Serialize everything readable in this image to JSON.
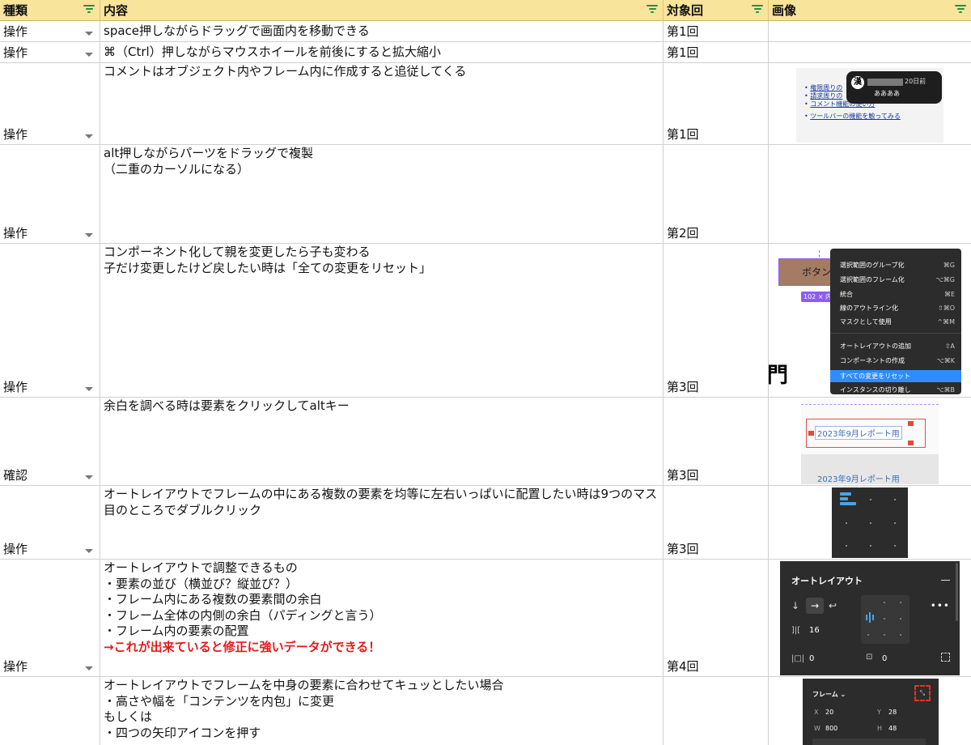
{
  "headers": {
    "type": "種類",
    "content": "内容",
    "round": "対象回",
    "image": "画像"
  },
  "rows": [
    {
      "type": "操作",
      "content": "space押しながらドラッグで画面内を移動できる",
      "round": "第1回"
    },
    {
      "type": "操作",
      "content": "⌘（Ctrl）押しながらマウスホイールを前後にすると拡大縮小",
      "round": "第1回"
    },
    {
      "type": "操作",
      "content": "コメントはオブジェクト内やフレーム内に作成すると追従してくる",
      "round": "第1回"
    },
    {
      "type": "操作",
      "content": "alt押しながらパーツをドラッグで複製\n（二重のカーソルになる）",
      "round": "第2回"
    },
    {
      "type": "操作",
      "content": "コンポーネント化して親を変更したら子も変わる\n子だけ変更したけど戻したい時は「全ての変更をリセット」",
      "round": "第3回"
    },
    {
      "type": "確認",
      "content": "余白を調べる時は要素をクリックしてaltキー",
      "round": "第3回"
    },
    {
      "type": "操作",
      "content": "オートレイアウトでフレームの中にある複数の要素を均等に左右いっぱいに配置したい時は9つのマス目のところでダブルクリック",
      "round": "第3回"
    },
    {
      "type": "操作",
      "content": "オートレイアウトで調整できるもの\n・要素の並び（横並び？縦並び？）\n・フレーム内にある複数の要素間の余白\n・フレーム全体の内側の余白（パディングと言う）\n・フレーム内の要素の配置\n",
      "content_emphasis": "→これが出来ていると修正に強いデータができる！",
      "round": "第4回"
    },
    {
      "type": "",
      "content": "オートレイアウトでフレームを中身の要素に合わせてキュッとしたい場合\n・高さや幅を「コンテンツを内包」に変更\nもしくは\n・四つの矢印アイコンを押す",
      "round": ""
    }
  ],
  "thumbs": {
    "comment": {
      "list": [
        "権限周りの",
        "請求周りの",
        "コメント機能の使い方",
        "ツールバーの機能を触ってみる"
      ],
      "avatar": "漢",
      "time": "20日前",
      "text": "ああああ"
    },
    "context_menu": {
      "button": "ボタン",
      "size": "102 × 内包",
      "items": [
        {
          "label": "選択範囲のグループ化",
          "key": "⌘G"
        },
        {
          "label": "選択範囲のフレーム化",
          "key": "⌥⌘G"
        },
        {
          "label": "統合",
          "key": "⌘E"
        },
        {
          "label": "線のアウトライン化",
          "key": "⇧⌘O"
        },
        {
          "label": "マスクとして使用",
          "key": "^⌘M"
        },
        {
          "label": "オートレイアウトの追加",
          "key": "⇧A"
        },
        {
          "label": "コンポーネントの作成",
          "key": "⌥⌘K"
        },
        {
          "label": "すべての変更をリセット",
          "key": ""
        },
        {
          "label": "インスタンスの切り離し",
          "key": "⌥⌘B"
        }
      ],
      "glyph": "門"
    },
    "spacing": {
      "label1": "2023年9月レポート用",
      "label2": "2023年9月レポート用"
    },
    "autolayout": {
      "title": "オートレイアウト",
      "gap": "16",
      "pad_h": "0",
      "pad_v": "0"
    },
    "frame": {
      "title": "フレーム",
      "x_label": "X",
      "x": "20",
      "y_label": "Y",
      "y": "28",
      "w_label": "W",
      "w": "800",
      "h_label": "H",
      "h": "48"
    }
  },
  "colors": {
    "header_bg": "#f8e49a",
    "emphasis": "#e21b1b",
    "figma_dark": "#2c2c2c",
    "figma_blue": "#2f8cff"
  }
}
